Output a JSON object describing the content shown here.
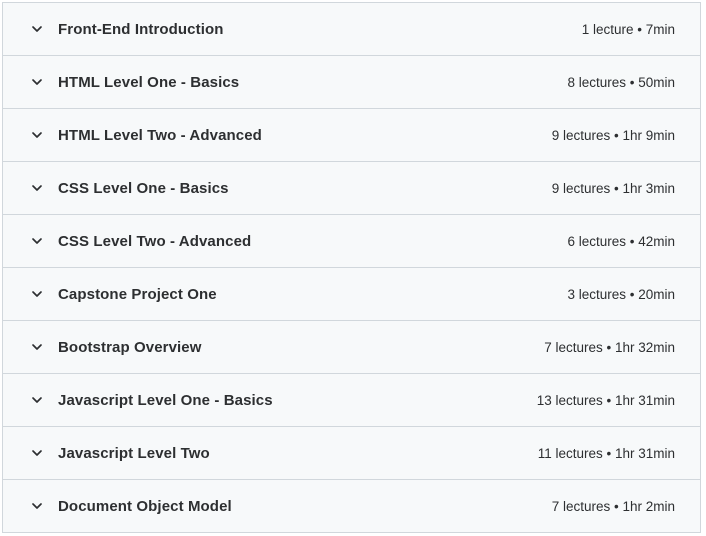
{
  "sections": [
    {
      "title": "Front-End Introduction",
      "meta": "1 lecture • 7min"
    },
    {
      "title": "HTML Level One - Basics",
      "meta": "8 lectures • 50min"
    },
    {
      "title": "HTML Level Two - Advanced",
      "meta": "9 lectures • 1hr 9min"
    },
    {
      "title": "CSS Level One - Basics",
      "meta": "9 lectures • 1hr 3min"
    },
    {
      "title": "CSS Level Two - Advanced",
      "meta": "6 lectures • 42min"
    },
    {
      "title": "Capstone Project One",
      "meta": "3 lectures • 20min"
    },
    {
      "title": "Bootstrap Overview",
      "meta": "7 lectures • 1hr 32min"
    },
    {
      "title": "Javascript Level One - Basics",
      "meta": "13 lectures • 1hr 31min"
    },
    {
      "title": "Javascript Level Two",
      "meta": "11 lectures • 1hr 31min"
    },
    {
      "title": "Document Object Model",
      "meta": "7 lectures • 1hr 2min"
    }
  ],
  "icon": "chevron-down-icon"
}
